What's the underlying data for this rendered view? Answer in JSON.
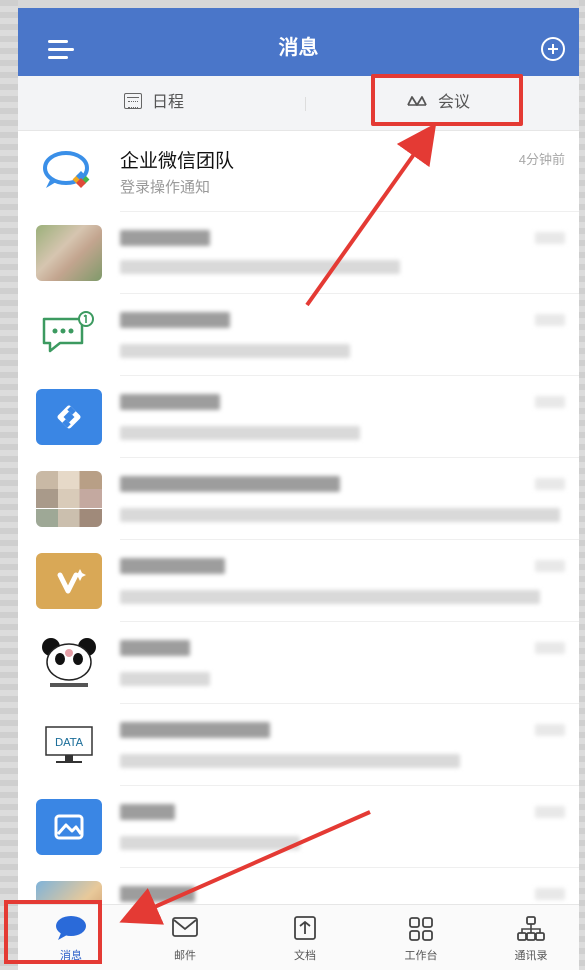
{
  "header": {
    "title": "消息"
  },
  "subtabs": {
    "schedule": "日程",
    "meeting": "会议"
  },
  "messages": [
    {
      "name": "企业微信团队",
      "preview": "登录操作通知",
      "time": "4分钟前"
    }
  ],
  "tabbar": {
    "messages": "消息",
    "mail": "邮件",
    "docs": "文档",
    "workbench": "工作台",
    "contacts": "通讯录"
  },
  "colors": {
    "header_bg": "#4a76c9",
    "accent_blue": "#2a5ec8",
    "annotation_red": "#e43a34"
  }
}
